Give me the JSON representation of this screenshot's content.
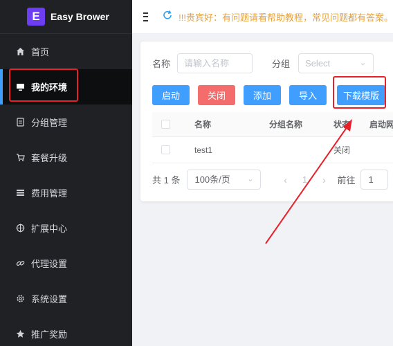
{
  "brand": {
    "logo_letter": "E",
    "name": "Easy Brower"
  },
  "sidebar": {
    "items": [
      {
        "label": "首页",
        "icon": "home-icon"
      },
      {
        "label": "我的环境",
        "icon": "monitor-icon"
      },
      {
        "label": "分组管理",
        "icon": "document-icon"
      },
      {
        "label": "套餐升级",
        "icon": "cart-icon"
      },
      {
        "label": "费用管理",
        "icon": "list-icon"
      },
      {
        "label": "扩展中心",
        "icon": "crosshair-icon"
      },
      {
        "label": "代理设置",
        "icon": "link-icon"
      },
      {
        "label": "系统设置",
        "icon": "gear-icon"
      },
      {
        "label": "推广奖励",
        "icon": "star-icon"
      }
    ]
  },
  "header": {
    "notice": "!!!贵宾好：有问题请看帮助教程，常见问题都有答案。"
  },
  "search": {
    "name_label": "名称",
    "name_placeholder": "请输入名称",
    "group_label": "分组",
    "group_placeholder": "Select"
  },
  "toolbar": {
    "start": "启动",
    "close": "关闭",
    "add": "添加",
    "import": "导入",
    "download_template": "下载模版"
  },
  "table": {
    "headers": {
      "name": "名称",
      "group": "分组名称",
      "status": "状态",
      "launch": "启动网"
    },
    "rows": [
      {
        "name": "test1",
        "group": "",
        "status": "关闭",
        "launch": ""
      }
    ]
  },
  "pagination": {
    "total": "共 1 条",
    "page_size": "100条/页",
    "current_page": "1",
    "goto_label": "前往",
    "goto_value": "1"
  },
  "colors": {
    "accent": "#409eff",
    "danger": "#f56c6c",
    "highlight": "#e8202a",
    "sidebar_bg": "#1f2124"
  }
}
